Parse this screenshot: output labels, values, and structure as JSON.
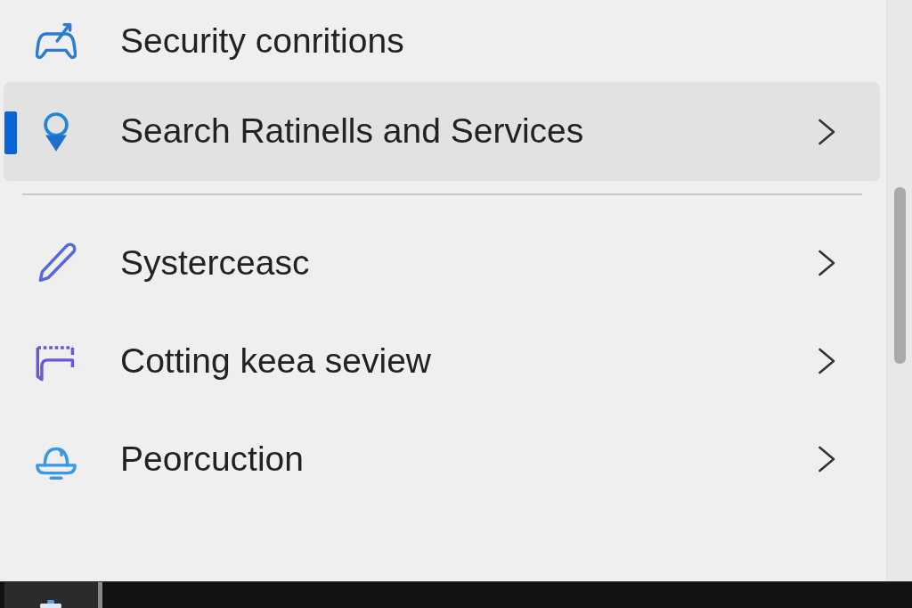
{
  "menu": {
    "groups": [
      {
        "items": [
          {
            "label": "Security conritions",
            "selected": false,
            "chevron": false
          },
          {
            "label": "Search Ratinells and Services",
            "selected": true,
            "chevron": true
          }
        ]
      },
      {
        "items": [
          {
            "label": "Systerceasc",
            "selected": false,
            "chevron": true
          },
          {
            "label": "Cotting keea seview",
            "selected": false,
            "chevron": true
          },
          {
            "label": "Peorcuction",
            "selected": false,
            "chevron": true
          }
        ]
      }
    ]
  }
}
